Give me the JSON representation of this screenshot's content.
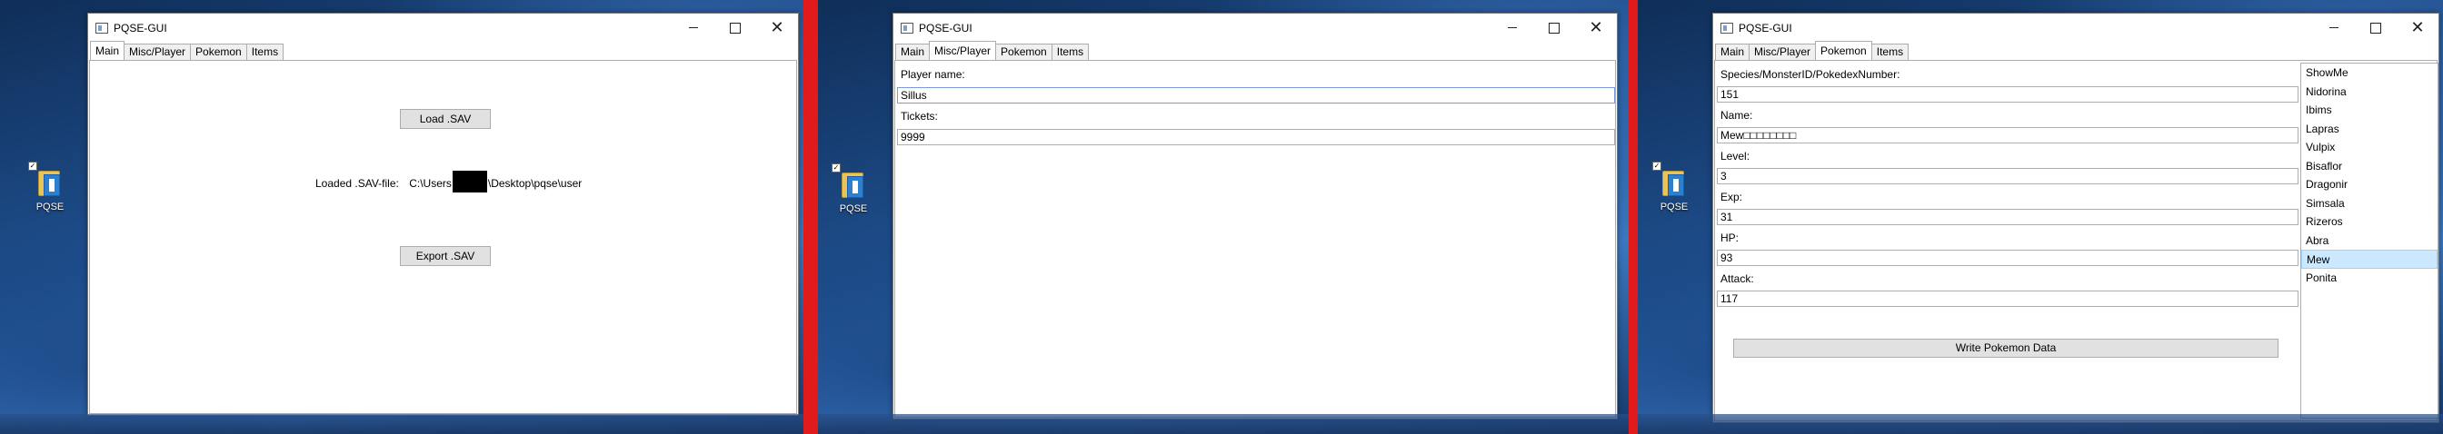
{
  "desktop": {
    "icon_label": "PQSE"
  },
  "windows": [
    {
      "title": "PQSE-GUI",
      "tabs": [
        "Main",
        "Misc/Player",
        "Pokemon",
        "Items"
      ],
      "main": {
        "load_button": "Load .SAV",
        "loaded_label": "Loaded .SAV-file:",
        "path_prefix": "C:\\Users",
        "path_suffix": "\\Desktop\\pqse\\user",
        "export_button": "Export .SAV"
      }
    },
    {
      "title": "PQSE-GUI",
      "tabs": [
        "Main",
        "Misc/Player",
        "Pokemon",
        "Items"
      ],
      "misc": {
        "player_name_label": "Player name:",
        "player_name_value": "Sillus",
        "tickets_label": "Tickets:",
        "tickets_value": "9999"
      }
    },
    {
      "title": "PQSE-GUI",
      "tabs": [
        "Main",
        "Misc/Player",
        "Pokemon",
        "Items"
      ],
      "pokemon": {
        "fields": [
          {
            "label": "Species/MonsterID/PokedexNumber:",
            "value": "151"
          },
          {
            "label": "Name:",
            "value": "Mew□□□□□□□□"
          },
          {
            "label": "Level:",
            "value": "3"
          },
          {
            "label": "Exp:",
            "value": "31"
          },
          {
            "label": "HP:",
            "value": "93"
          },
          {
            "label": "Attack:",
            "value": "117"
          }
        ],
        "write_button": "Write Pokemon Data",
        "list": [
          "ShowMe",
          "Nidorina",
          "Ibims",
          "Lapras",
          "Vulpix",
          "Bisaflor",
          "Dragonir",
          "Simsala",
          "Rizeros",
          "Abra",
          "Mew",
          "Ponita"
        ],
        "selected_index": 10
      }
    }
  ],
  "colors": {
    "separator": "#e11b1b",
    "selection": "#cce8ff",
    "focus_border": "#7a9cd6"
  }
}
